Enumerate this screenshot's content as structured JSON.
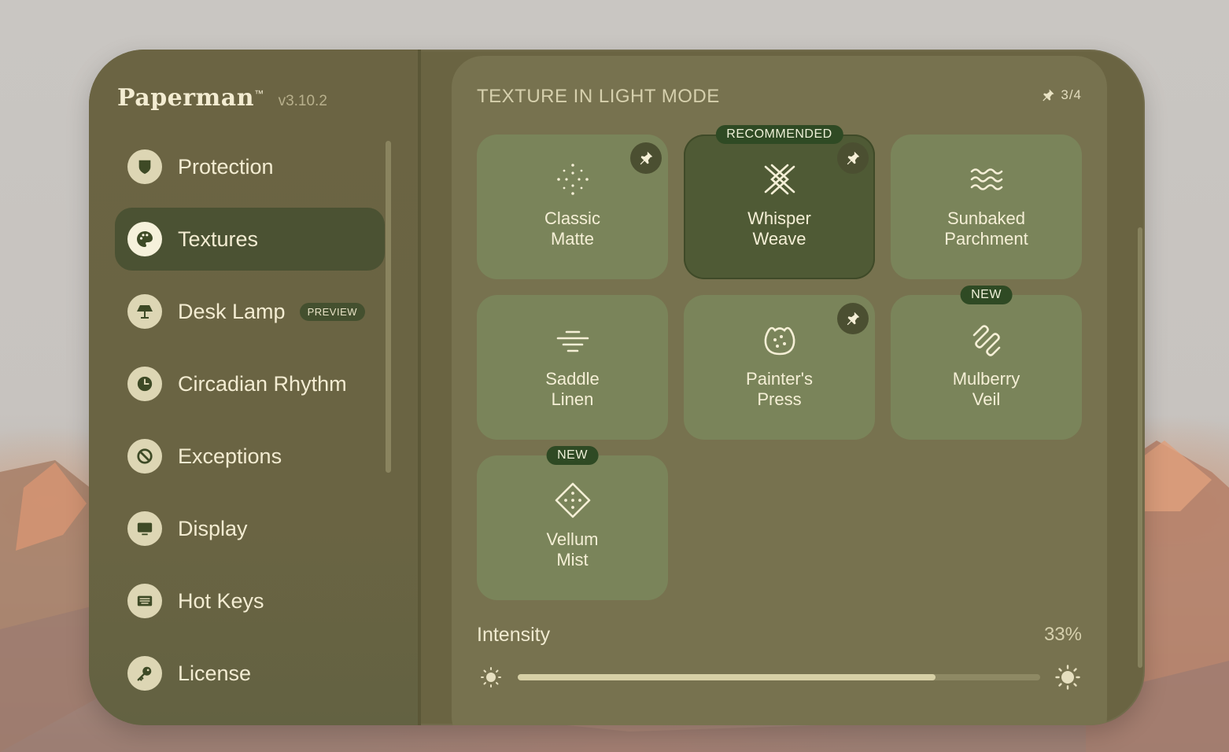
{
  "app": {
    "name": "Paperman",
    "trademark": "™",
    "version": "v3.10.2"
  },
  "sidebar": {
    "items": [
      {
        "label": "Protection",
        "icon": "shield-icon",
        "active": false
      },
      {
        "label": "Textures",
        "icon": "palette-icon",
        "active": true
      },
      {
        "label": "Desk Lamp",
        "icon": "lamp-icon",
        "active": false,
        "badge": "PREVIEW"
      },
      {
        "label": "Circadian Rhythm",
        "icon": "clock-icon",
        "active": false
      },
      {
        "label": "Exceptions",
        "icon": "block-icon",
        "active": false
      },
      {
        "label": "Display",
        "icon": "monitor-icon",
        "active": false
      },
      {
        "label": "Hot Keys",
        "icon": "keyboard-icon",
        "active": false
      },
      {
        "label": "License",
        "icon": "key-icon",
        "active": false
      }
    ]
  },
  "main": {
    "title": "TEXTURE IN LIGHT MODE",
    "pin_count": "3/4",
    "textures": [
      {
        "label": "Classic\nMatte",
        "icon": "sparkle-dots-icon",
        "pinned": true,
        "selected": false,
        "badge": ""
      },
      {
        "label": "Whisper\nWeave",
        "icon": "weave-icon",
        "pinned": true,
        "selected": true,
        "badge": "RECOMMENDED"
      },
      {
        "label": "Sunbaked\nParchment",
        "icon": "waves-icon",
        "pinned": false,
        "selected": false,
        "badge": ""
      },
      {
        "label": "Saddle\nLinen",
        "icon": "lines-icon",
        "pinned": false,
        "selected": false,
        "badge": ""
      },
      {
        "label": "Painter's\nPress",
        "icon": "cookie-icon",
        "pinned": true,
        "selected": false,
        "badge": ""
      },
      {
        "label": "Mulberry\nVeil",
        "icon": "squiggle-icon",
        "pinned": false,
        "selected": false,
        "badge": "NEW"
      },
      {
        "label": "Vellum\nMist",
        "icon": "diamond-dots-icon",
        "pinned": false,
        "selected": false,
        "badge": "NEW"
      }
    ],
    "intensity": {
      "label": "Intensity",
      "value_text": "33%",
      "fill_fraction": 0.8
    }
  },
  "colors": {
    "window": "#6a6442",
    "panel": "#77724f",
    "card": "#7a845a",
    "card_selected": "#4f5a35",
    "accent": "#2f4a24",
    "text": "#f5efd6"
  }
}
